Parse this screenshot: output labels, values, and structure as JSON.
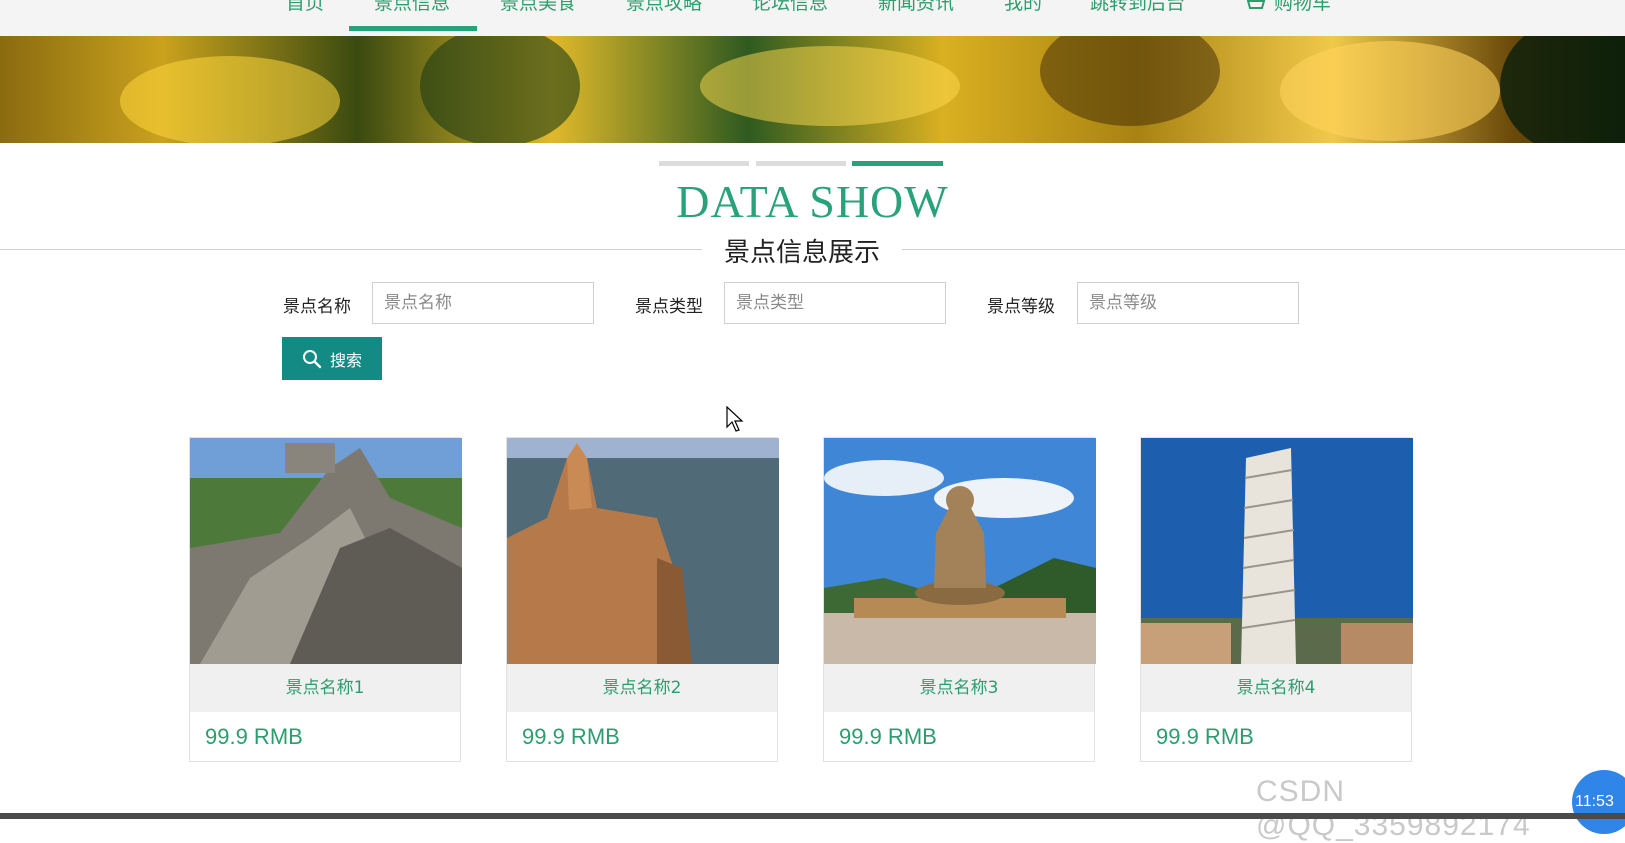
{
  "nav": {
    "items": [
      "首页",
      "景点信息",
      "景点美食",
      "景点攻略",
      "论坛信息",
      "新闻资讯",
      "我的",
      "跳转到后台",
      "购物车"
    ],
    "active_index": 1,
    "accent": "#27a27a"
  },
  "section": {
    "title": "DATA SHOW",
    "subtitle": "景点信息展示"
  },
  "search": {
    "name_label": "景点名称",
    "name_placeholder": "景点名称",
    "type_label": "景点类型",
    "type_placeholder": "景点类型",
    "level_label": "景点等级",
    "level_placeholder": "景点等级",
    "button_label": "搜索",
    "button_color": "#138a84"
  },
  "cards": [
    {
      "name": "景点名称1",
      "price": "99.9 RMB",
      "image": "great-wall"
    },
    {
      "name": "景点名称2",
      "price": "99.9 RMB",
      "image": "sea-cliff"
    },
    {
      "name": "景点名称3",
      "price": "99.9 RMB",
      "image": "buddha-statue"
    },
    {
      "name": "景点名称4",
      "price": "99.9 RMB",
      "image": "leaning-tower"
    }
  ],
  "watermark": "CSDN @QQ_3359892174",
  "clock": "11:53"
}
